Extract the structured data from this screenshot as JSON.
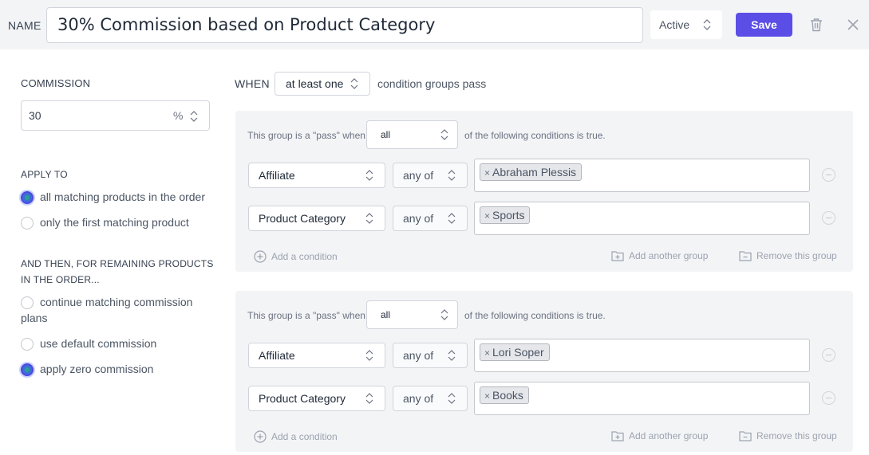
{
  "header": {
    "name_label": "NAME",
    "name_value": "30% Commission based on Product Category",
    "status": "Active",
    "save_label": "Save"
  },
  "commission": {
    "label": "COMMISSION",
    "value": "30",
    "unit": "%"
  },
  "apply_to": {
    "label": "APPLY TO",
    "options": [
      {
        "label": "all matching products in the order",
        "selected": true
      },
      {
        "label": "only the first matching product",
        "selected": false
      }
    ]
  },
  "remaining": {
    "label_line1": "AND THEN, FOR REMAINING PRODUCTS",
    "label_line2": "IN THE ORDER...",
    "options": [
      {
        "label_line1": "continue matching commission",
        "label_line2": "plans",
        "selected": false
      },
      {
        "label_line1": "use default commission",
        "label_line2": "",
        "selected": false
      },
      {
        "label_line1": "apply zero commission",
        "label_line2": "",
        "selected": true
      }
    ]
  },
  "when": {
    "label": "WHEN",
    "mode": "at least one",
    "suffix": "condition groups pass"
  },
  "groups": [
    {
      "prefix": "This group is a \"pass\" when",
      "match": "all",
      "suffix": "of the following conditions is true.",
      "conditions": [
        {
          "field": "Affiliate",
          "operator": "any of",
          "value": "Abraham Plessis"
        },
        {
          "field": "Product Category",
          "operator": "any of",
          "value": "Sports"
        }
      ],
      "add_condition": "Add a condition",
      "add_group": "Add another group",
      "remove_group": "Remove this group"
    },
    {
      "prefix": "This group is a \"pass\" when",
      "match": "all",
      "suffix": "of the following conditions is true.",
      "conditions": [
        {
          "field": "Affiliate",
          "operator": "any of",
          "value": "Lori Soper"
        },
        {
          "field": "Product Category",
          "operator": "any of",
          "value": "Books"
        }
      ],
      "add_condition": "Add a condition",
      "add_group": "Add another group",
      "remove_group": "Remove this group"
    }
  ],
  "colors": {
    "primary": "#5b4ee6",
    "panel": "#f3f4f6"
  },
  "icons": [
    "trash-icon",
    "close-icon",
    "plus-circle-icon",
    "add-folder-icon",
    "remove-folder-icon",
    "minus-circle-icon",
    "updown-chevron-icon"
  ]
}
